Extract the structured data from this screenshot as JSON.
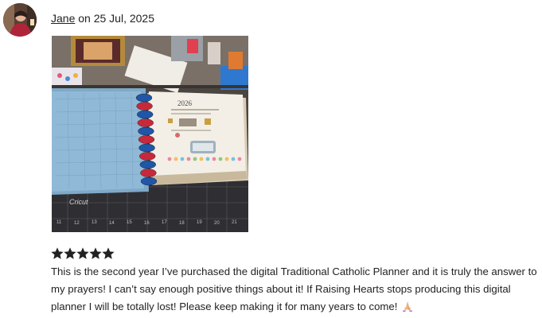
{
  "review": {
    "reviewer": "Jane",
    "date_text": "on 25 Jul, 2025",
    "rating": 5,
    "rating_max": 5,
    "text": "This is the second year I’ve purchased the digital Traditional Catholic Planner and it is truly the answer to my prayers! I can’t say enough positive things about it! If Raising Hearts stops producing this digital planner I will be totally lost! Please keep making it for many years to come!",
    "emoji_icon": "praying-hands-icon"
  },
  "photo": {
    "cover_year": "2026",
    "mat_brand": "Cricut",
    "ruler_numbers": [
      "11",
      "12",
      "13",
      "14",
      "15",
      "16",
      "17",
      "18",
      "19",
      "20",
      "21"
    ]
  },
  "colors": {
    "star": "#222222",
    "text": "#222222",
    "binder_cover": "#8fb9d6",
    "disc_red": "#c8283c",
    "disc_blue": "#1f56a8"
  }
}
